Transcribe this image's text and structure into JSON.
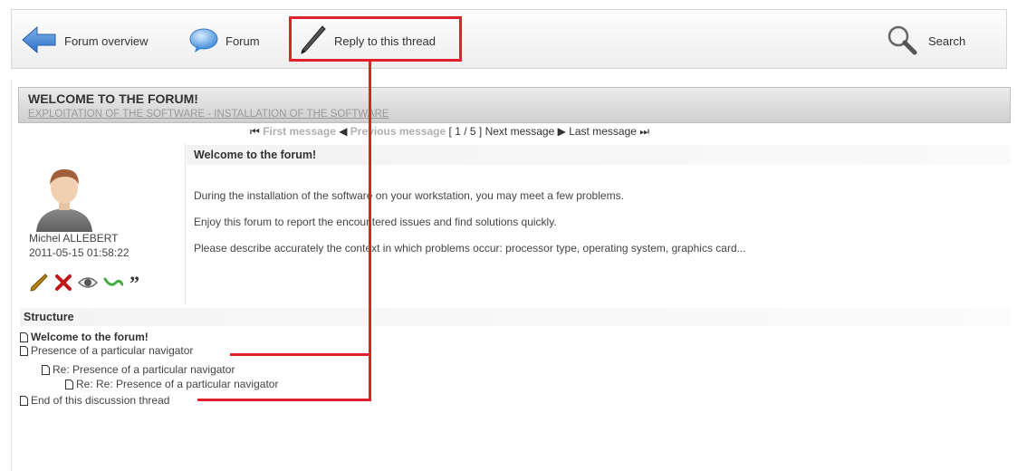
{
  "toolbar": {
    "forum_overview": "Forum overview",
    "forum": "Forum",
    "reply": "Reply to this thread",
    "search": "Search"
  },
  "header": {
    "title": "WELCOME TO THE FORUM!",
    "subtitle": "EXPLOITATION OF THE SOFTWARE - INSTALLATION OF THE SOFTWARE"
  },
  "pager": {
    "first": "First message",
    "previous": "Previous message",
    "position": "[ 1 / 5 ]",
    "next": "Next message",
    "last": "Last message"
  },
  "post": {
    "author": "Michel ALLEBERT",
    "date": "2011-05-15 01:58:22",
    "title": "Welcome to the forum!",
    "lines": [
      "During the installation of the software on your workstation, you may meet a few problems.",
      "Enjoy this forum to report the encountered issues and find solutions quickly.",
      "Please describe accurately the context in which problems occur: processor type, operating system, graphics card..."
    ],
    "actions": [
      "pencil-icon",
      "delete-icon",
      "view-icon",
      "reply-icon",
      "quote-icon"
    ]
  },
  "structure": {
    "title": "Structure",
    "items": [
      {
        "label": "Welcome to the forum!",
        "level": 0,
        "current": true
      },
      {
        "label": "Presence of a particular navigator",
        "level": 0
      },
      {
        "label": "Re: Presence of a particular navigator",
        "level": 1
      },
      {
        "label": "Re: Re: Presence of a particular navigator",
        "level": 2
      },
      {
        "label": "End of this discussion thread",
        "level": 0
      }
    ]
  },
  "colors": {
    "annotation_red": "#e0212b",
    "arrow_blue": "#3a7fd0"
  }
}
